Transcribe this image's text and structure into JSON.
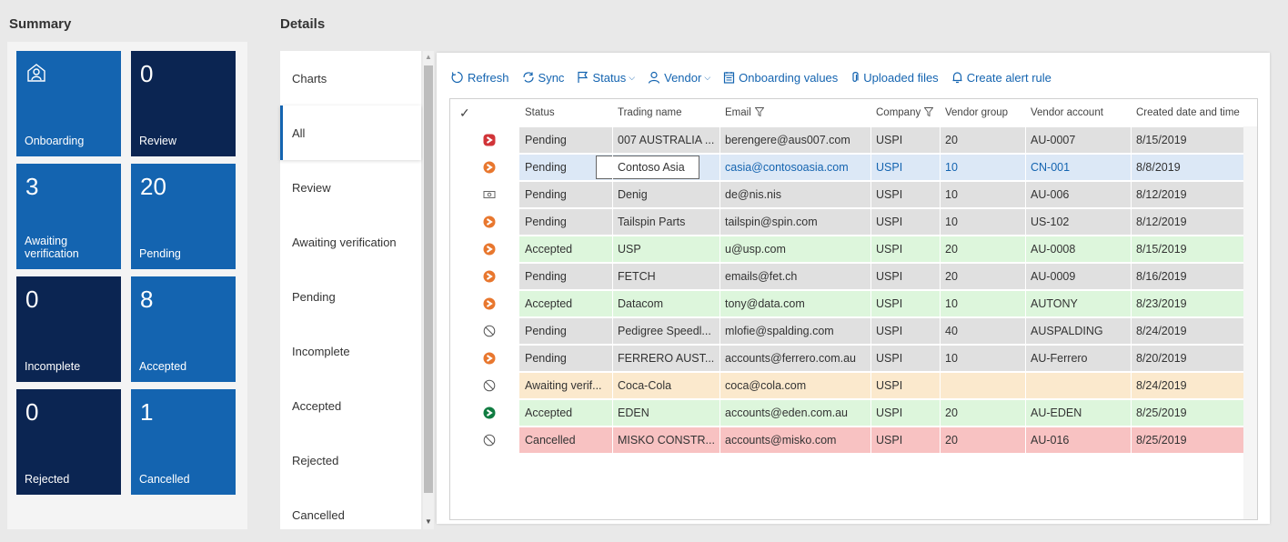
{
  "summary": {
    "title": "Summary",
    "tiles": [
      {
        "label": "Onboarding",
        "icon": "onboarding-icon",
        "style": "light"
      },
      {
        "value": "0",
        "label": "Review",
        "style": "dark"
      },
      {
        "value": "3",
        "label": "Awaiting verification",
        "style": "light"
      },
      {
        "value": "20",
        "label": "Pending",
        "style": "light"
      },
      {
        "value": "0",
        "label": "Incomplete",
        "style": "dark"
      },
      {
        "value": "8",
        "label": "Accepted",
        "style": "light"
      },
      {
        "value": "0",
        "label": "Rejected",
        "style": "dark"
      },
      {
        "value": "1",
        "label": "Cancelled",
        "style": "light"
      }
    ]
  },
  "details": {
    "title": "Details",
    "nav": [
      "Charts",
      "All",
      "Review",
      "Awaiting verification",
      "Pending",
      "Incomplete",
      "Accepted",
      "Rejected",
      "Cancelled"
    ],
    "active_nav": "All"
  },
  "toolbar": {
    "refresh": "Refresh",
    "sync": "Sync",
    "status": "Status",
    "vendor": "Vendor",
    "onboarding_values": "Onboarding values",
    "uploaded_files": "Uploaded files",
    "create_alert_rule": "Create alert rule"
  },
  "grid": {
    "columns": [
      "Status",
      "Trading name",
      "Email",
      "Company",
      "Vendor group",
      "Vendor account",
      "Created date and time"
    ],
    "rows": [
      {
        "icon": "red",
        "status": "Pending",
        "trading_name": "007 AUSTRALIA ...",
        "email": "berengere@aus007.com",
        "company": "USPI",
        "vendor_group": "20",
        "vendor_account": "AU-0007",
        "created": "8/15/2019",
        "color": "#e0e0e0"
      },
      {
        "icon": "orange",
        "status": "Pending",
        "trading_name": "Contoso Asia",
        "email": "casia@contosoasia.com",
        "company": "USPI",
        "vendor_group": "10",
        "vendor_account": "CN-001",
        "created": "8/8/2019",
        "color": "#dce8f6",
        "selected": true
      },
      {
        "icon": "card",
        "status": "Pending",
        "trading_name": "Denig",
        "email": "de@nis.nis",
        "company": "USPI",
        "vendor_group": "10",
        "vendor_account": "AU-006",
        "created": "8/12/2019",
        "color": "#e0e0e0"
      },
      {
        "icon": "orange",
        "status": "Pending",
        "trading_name": "Tailspin Parts",
        "email": "tailspin@spin.com",
        "company": "USPI",
        "vendor_group": "10",
        "vendor_account": "US-102",
        "created": "8/12/2019",
        "color": "#e0e0e0"
      },
      {
        "icon": "orange",
        "status": "Accepted",
        "trading_name": "USP",
        "email": "u@usp.com",
        "company": "USPI",
        "vendor_group": "20",
        "vendor_account": "AU-0008",
        "created": "8/15/2019",
        "color": "#ddf6dc"
      },
      {
        "icon": "orange",
        "status": "Pending",
        "trading_name": "FETCH",
        "email": "emails@fet.ch",
        "company": "USPI",
        "vendor_group": "20",
        "vendor_account": "AU-0009",
        "created": "8/16/2019",
        "color": "#e0e0e0"
      },
      {
        "icon": "orange",
        "status": "Accepted",
        "trading_name": "Datacom",
        "email": "tony@data.com",
        "company": "USPI",
        "vendor_group": "10",
        "vendor_account": "AUTONY",
        "created": "8/23/2019",
        "color": "#ddf6dc"
      },
      {
        "icon": "block",
        "status": "Pending",
        "trading_name": "Pedigree Speedl...",
        "email": "mlofie@spalding.com",
        "company": "USPI",
        "vendor_group": "40",
        "vendor_account": "AUSPALDING",
        "created": "8/24/2019",
        "color": "#e0e0e0"
      },
      {
        "icon": "orange",
        "status": "Pending",
        "trading_name": "FERRERO AUST...",
        "email": "accounts@ferrero.com.au",
        "company": "USPI",
        "vendor_group": "10",
        "vendor_account": "AU-Ferrero",
        "created": "8/20/2019",
        "color": "#e0e0e0"
      },
      {
        "icon": "block",
        "status": "Awaiting verif...",
        "trading_name": "Coca-Cola",
        "email": "coca@cola.com",
        "company": "USPI",
        "vendor_group": "",
        "vendor_account": "",
        "created": "8/24/2019",
        "color": "#fbe9cd"
      },
      {
        "icon": "green",
        "status": "Accepted",
        "trading_name": "EDEN",
        "email": "accounts@eden.com.au",
        "company": "USPI",
        "vendor_group": "20",
        "vendor_account": "AU-EDEN",
        "created": "8/25/2019",
        "color": "#ddf6dc"
      },
      {
        "icon": "block",
        "status": "Cancelled",
        "trading_name": "MISKO CONSTR...",
        "email": "accounts@misko.com",
        "company": "USPI",
        "vendor_group": "20",
        "vendor_account": "AU-016",
        "created": "8/25/2019",
        "color": "#f8c2c2"
      }
    ]
  },
  "colors": {
    "accent": "#1464b0",
    "tile_light": "#1464b0",
    "tile_dark": "#0b2552",
    "orange": "#e8772e",
    "red": "#d13438",
    "green": "#107c41"
  }
}
